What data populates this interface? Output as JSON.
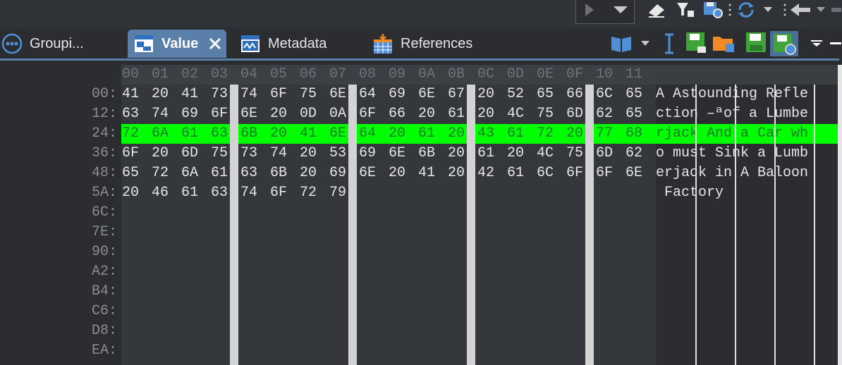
{
  "tabs": [
    {
      "label": "Groupi...",
      "icon": "grouping-icon"
    },
    {
      "label": "Value",
      "icon": "value-icon",
      "active": true
    },
    {
      "label": "Metadata",
      "icon": "metadata-icon"
    },
    {
      "label": "References",
      "icon": "references-icon"
    }
  ],
  "column_headers": [
    "00",
    "01",
    "02",
    "03",
    "04",
    "05",
    "06",
    "07",
    "08",
    "09",
    "0A",
    "0B",
    "0C",
    "0D",
    "0E",
    "0F",
    "10",
    "11"
  ],
  "rows": [
    {
      "addr": "00:",
      "bytes": [
        "41",
        "20",
        "41",
        "73",
        "74",
        "6F",
        "75",
        "6E",
        "64",
        "69",
        "6E",
        "67",
        "20",
        "52",
        "65",
        "66",
        "6C",
        "65"
      ],
      "ascii": "A Astounding Refle"
    },
    {
      "addr": "12:",
      "bytes": [
        "63",
        "74",
        "69",
        "6F",
        "6E",
        "20",
        "0D",
        "0A",
        "6F",
        "66",
        "20",
        "61",
        "20",
        "4C",
        "75",
        "6D",
        "62",
        "65"
      ],
      "ascii": "ction –ªof a Lumbe"
    },
    {
      "addr": "24:",
      "bytes": [
        "72",
        "6A",
        "61",
        "63",
        "6B",
        "20",
        "41",
        "6E",
        "64",
        "20",
        "61",
        "20",
        "43",
        "61",
        "72",
        "20",
        "77",
        "68"
      ],
      "ascii": "rjack And a Car wh",
      "highlight": true
    },
    {
      "addr": "36:",
      "bytes": [
        "6F",
        "20",
        "6D",
        "75",
        "73",
        "74",
        "20",
        "53",
        "69",
        "6E",
        "6B",
        "20",
        "61",
        "20",
        "4C",
        "75",
        "6D",
        "62"
      ],
      "ascii": "o must Sink a Lumb"
    },
    {
      "addr": "48:",
      "bytes": [
        "65",
        "72",
        "6A",
        "61",
        "63",
        "6B",
        "20",
        "69",
        "6E",
        "20",
        "41",
        "20",
        "42",
        "61",
        "6C",
        "6F",
        "6F",
        "6E"
      ],
      "ascii": "erjack in A Baloon"
    },
    {
      "addr": "5A:",
      "bytes": [
        "20",
        "46",
        "61",
        "63",
        "74",
        "6F",
        "72",
        "79"
      ],
      "ascii": " Factory"
    },
    {
      "addr": "6C:",
      "bytes": [],
      "ascii": ""
    },
    {
      "addr": "7E:",
      "bytes": [],
      "ascii": ""
    },
    {
      "addr": "90:",
      "bytes": [],
      "ascii": ""
    },
    {
      "addr": "A2:",
      "bytes": [],
      "ascii": ""
    },
    {
      "addr": "B4:",
      "bytes": [],
      "ascii": ""
    },
    {
      "addr": "C6:",
      "bytes": [],
      "ascii": ""
    },
    {
      "addr": "D8:",
      "bytes": [],
      "ascii": ""
    },
    {
      "addr": "EA:",
      "bytes": [],
      "ascii": ""
    }
  ],
  "colors": {
    "highlight": "#00ff00",
    "accent": "#5a7fa8"
  }
}
